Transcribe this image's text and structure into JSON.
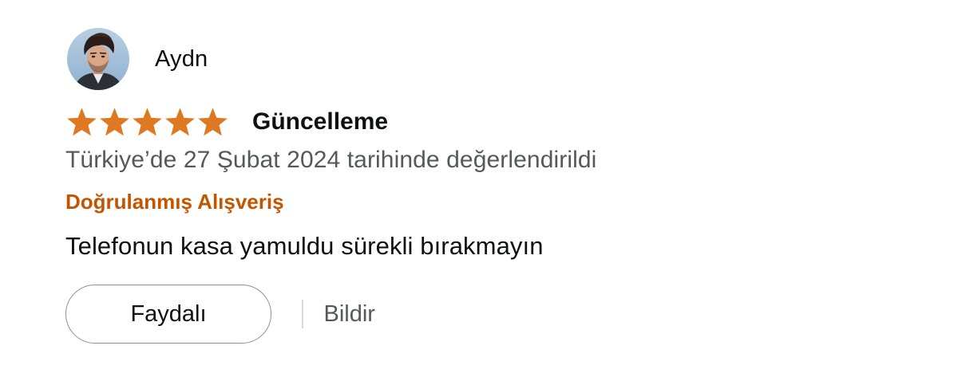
{
  "reviewer": {
    "name": "Aydn",
    "avatar_icon": "person-avatar-icon"
  },
  "review": {
    "rating": 5,
    "rating_max": 5,
    "star_color": "#de7921",
    "title": "Güncelleme",
    "date_text": "Türkiye’de 27 Şubat 2024 tarihinde değerlendirildi",
    "verified_label": "Doğrulanmış Alışveriş",
    "verified_color": "#c45500",
    "body": "Telefonun kasa yamuldu sürekli bırakmayın"
  },
  "actions": {
    "helpful_label": "Faydalı",
    "report_label": "Bildir"
  }
}
